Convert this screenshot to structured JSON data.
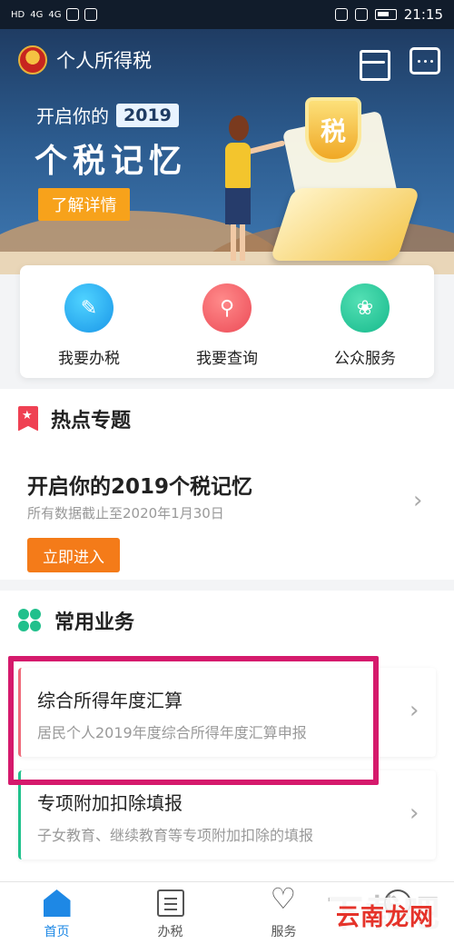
{
  "status_bar": {
    "left_labels": [
      "HD",
      "4G",
      "4G"
    ],
    "time": "21:15"
  },
  "app": {
    "title": "个人所得税"
  },
  "banner": {
    "line1_prefix": "开启你的",
    "year": "2019",
    "headline": "个税记忆",
    "button": "了解详情",
    "shield_text": "税"
  },
  "quick_actions": [
    {
      "label": "我要办税",
      "icon": "pencil-icon",
      "color": "#1a96e8"
    },
    {
      "label": "我要查询",
      "icon": "magnifier-icon",
      "color": "#ec4b57"
    },
    {
      "label": "公众服务",
      "icon": "flower-icon",
      "color": "#16b98c"
    }
  ],
  "hot_topics": {
    "section_title": "热点专题",
    "item_title": "开启你的2019个税记忆",
    "item_subtitle": "所有数据截止至2020年1月30日",
    "button": "立即进入"
  },
  "common_services": {
    "section_title": "常用业务",
    "items": [
      {
        "title": "综合所得年度汇算",
        "subtitle": "居民个人2019年度综合所得年度汇算申报"
      },
      {
        "title": "专项附加扣除填报",
        "subtitle": "子女教育、继续教育等专项附加扣除的填报"
      }
    ]
  },
  "bottom_nav": {
    "items": [
      {
        "label": "首页",
        "icon": "home-icon",
        "active": true
      },
      {
        "label": "办税",
        "icon": "document-icon",
        "active": false
      },
      {
        "label": "服务",
        "icon": "heart-icon",
        "active": false
      },
      {
        "label": "",
        "icon": "user-icon",
        "active": false
      }
    ]
  },
  "watermark": {
    "text": "云南龙网",
    "bg_text": "下载吧"
  },
  "colors": {
    "primary_blue": "#1e88e5",
    "accent_orange": "#f47b19",
    "highlight_magenta": "#d51a6c"
  }
}
